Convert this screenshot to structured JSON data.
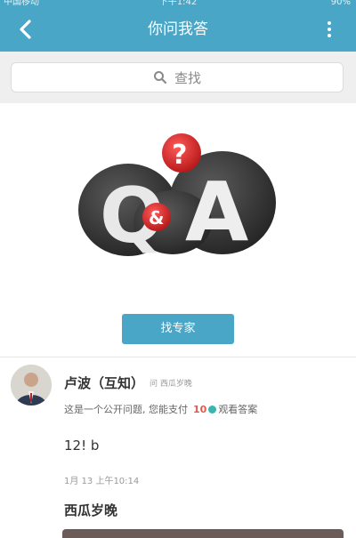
{
  "status_bar": {
    "carrier": "中国移动",
    "time": "下午1:42",
    "battery": "90%"
  },
  "header": {
    "title": "你问我答"
  },
  "search": {
    "placeholder": "查找"
  },
  "banner": {
    "cta_label": "找专家"
  },
  "post": {
    "user_name": "卢波（互知）",
    "user_meta": "问 西瓜岁晚",
    "question_text": "这是一个公开问题, 您能支付",
    "price": "10",
    "view_label": "观看答案",
    "body": "12! b",
    "timestamp": "1月 13 上午10:14",
    "answer_author": "西瓜岁晚"
  },
  "colors": {
    "accent": "#4aa6c7",
    "price": "#e05a4f"
  }
}
